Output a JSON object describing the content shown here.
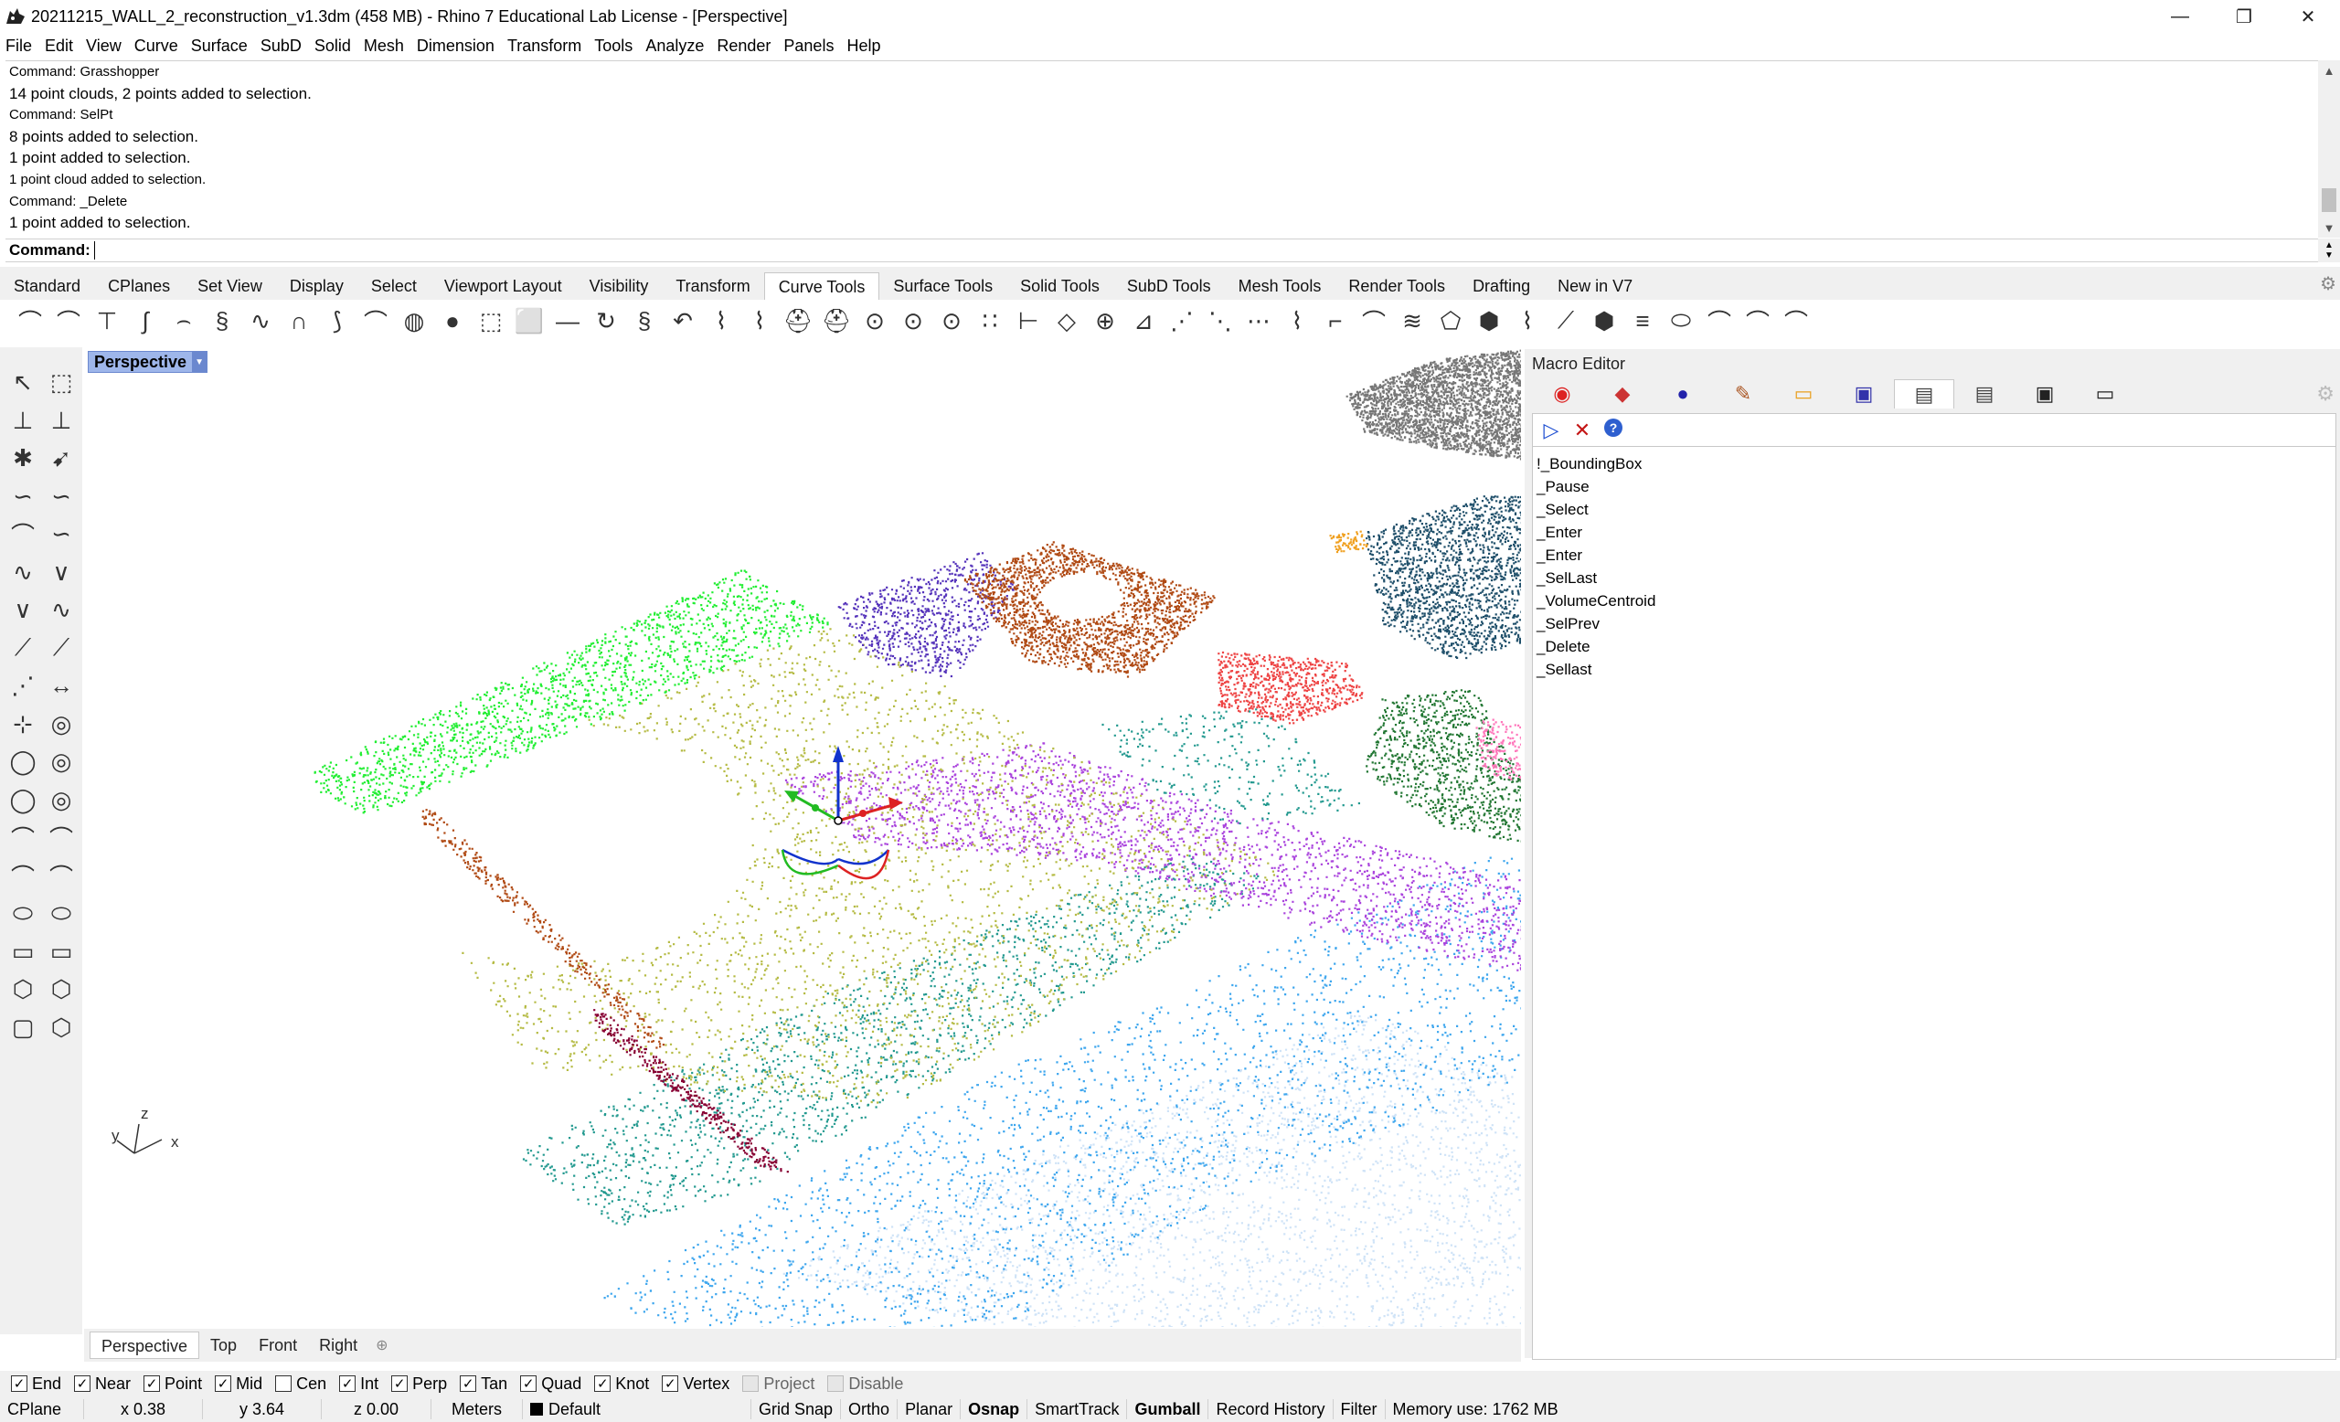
{
  "window": {
    "title": "20211215_WALL_2_reconstruction_v1.3dm (458 MB) - Rhino 7 Educational Lab License - [Perspective]",
    "minimize_glyph": "—",
    "restore_glyph": "❐",
    "close_glyph": "✕"
  },
  "menu": [
    "File",
    "Edit",
    "View",
    "Curve",
    "Surface",
    "SubD",
    "Solid",
    "Mesh",
    "Dimension",
    "Transform",
    "Tools",
    "Analyze",
    "Render",
    "Panels",
    "Help"
  ],
  "command_history": [
    {
      "text": "Command: Grasshopper",
      "size": "small"
    },
    {
      "text": "14 point clouds, 2 points added to selection.",
      "size": "big"
    },
    {
      "text": "Command: SelPt",
      "size": "small"
    },
    {
      "text": "8 points added to selection.",
      "size": "big"
    },
    {
      "text": "1 point added to selection.",
      "size": "big"
    },
    {
      "text": "1 point cloud added to selection.",
      "size": "small"
    },
    {
      "text": "Command: _Delete",
      "size": "small"
    },
    {
      "text": "1 point added to selection.",
      "size": "big"
    }
  ],
  "command_prompt": {
    "label": "Command:",
    "value": ""
  },
  "toolbar_tabs": {
    "items": [
      "Standard",
      "CPlanes",
      "Set View",
      "Display",
      "Select",
      "Viewport Layout",
      "Visibility",
      "Transform",
      "Curve Tools",
      "Surface Tools",
      "Solid Tools",
      "SubD Tools",
      "Mesh Tools",
      "Render Tools",
      "Drafting",
      "New in V7"
    ],
    "active": "Curve Tools"
  },
  "curve_tool_icons": [
    "fillet-curves-icon",
    "chamfer-curves-icon",
    "offset-curve-icon",
    "blend-curves-icon",
    "adjustable-blend-icon",
    "connect-curves-icon",
    "match-curve-icon",
    "arc-blend-icon",
    "tween-curves-icon",
    "extend-curve-icon",
    "extend-arc-icon",
    "point-on-curve-icon",
    "edit-points-icon",
    "project-to-surface-icon",
    "pull-curve-icon",
    "divide-curve-icon",
    "crv-start-icon",
    "crv-seam-icon",
    "change-degree-icon",
    "refit-curve-icon",
    "rebuild-curve-icon",
    "make-uniform-icon",
    "fit-curve-icon",
    "fix-curve-icon",
    "fair-curve-icon",
    "simplify-icon",
    "crv-length-icon",
    "divide-length-icon",
    "insert-point-icon",
    "remove-knot-icon",
    "curve-through-points-icon",
    "curve-through-polyline-icon",
    "symmetry-icon",
    "delete-segment-icon",
    "convert-polyline-icon",
    "explode-icon",
    "join-icon",
    "offset-multiple-icon",
    "sweep-icon",
    "flow-icon",
    "boundary-icon",
    "smooth-icon",
    "project-icon",
    "sketch-icon",
    "handle-curve-icon",
    "selected-curve-icon",
    "hatch-icon"
  ],
  "left_tool_icons": [
    "select-arrow-icon",
    "select-window-icon",
    "point-icon",
    "polyline-icon",
    "blend-icon",
    "arrow-icon",
    "interpolate-icon",
    "cv-curve-icon",
    "arc-icon",
    "rectangle-icon",
    "helix-icon",
    "spline-icon",
    "line-icon",
    "line-segment-icon",
    "polyline-2-icon",
    "line-2-icon",
    "point-2-icon",
    "arrow-2-icon",
    "circle-center-icon",
    "circle-tangent-icon",
    "circle-icon",
    "circle-2-icon",
    "arc-center-icon",
    "arc-2-icon",
    "arc-tangent-icon",
    "arc-3-icon",
    "ellipse-icon",
    "ellipse-2-icon",
    "rectangle-2-icon",
    "rectangle-3-icon",
    "polygon-icon",
    "polygon-2-icon",
    "freeform-icon",
    "box-icon",
    "cube-icon",
    "gumball-icon"
  ],
  "viewport": {
    "name": "Perspective",
    "axis_labels": {
      "x": "x",
      "y": "y",
      "z": "z"
    }
  },
  "viewport_tabs": {
    "items": [
      "Perspective",
      "Top",
      "Front",
      "Right"
    ],
    "active": "Perspective",
    "add_glyph": "⊕"
  },
  "panel": {
    "title": "Macro Editor",
    "tab_icons": [
      "color-wheel-icon",
      "material-icon",
      "environment-icon",
      "light-icon",
      "folder-icon",
      "layer-icon",
      "notes-icon",
      "document-icon",
      "camera-icon",
      "display-icon"
    ],
    "active_tab_index": 6,
    "macro_tool_icons": [
      "run-icon",
      "close-x-icon",
      "help-icon"
    ],
    "macro_lines": [
      "!_BoundingBox",
      "_Pause",
      "_Select",
      "_Enter",
      "_Enter",
      "_SelLast",
      "_VolumeCentroid",
      "_SelPrev",
      "_Delete",
      "_Sellast"
    ]
  },
  "osnaps": [
    {
      "label": "End",
      "checked": true
    },
    {
      "label": "Near",
      "checked": true
    },
    {
      "label": "Point",
      "checked": true
    },
    {
      "label": "Mid",
      "checked": true
    },
    {
      "label": "Cen",
      "checked": false
    },
    {
      "label": "Int",
      "checked": true
    },
    {
      "label": "Perp",
      "checked": true
    },
    {
      "label": "Tan",
      "checked": true
    },
    {
      "label": "Quad",
      "checked": true
    },
    {
      "label": "Knot",
      "checked": true
    },
    {
      "label": "Vertex",
      "checked": true
    },
    {
      "label": "Project",
      "checked": false,
      "disabled": true
    },
    {
      "label": "Disable",
      "checked": false,
      "disabled": true
    }
  ],
  "status": {
    "cplane": "CPlane",
    "x": "x 0.38",
    "y": "y 3.64",
    "z": "z 0.00",
    "units": "Meters",
    "layer": "Default",
    "toggles": [
      {
        "label": "Grid Snap",
        "bold": false
      },
      {
        "label": "Ortho",
        "bold": false
      },
      {
        "label": "Planar",
        "bold": false
      },
      {
        "label": "Osnap",
        "bold": true
      },
      {
        "label": "SmartTrack",
        "bold": false
      },
      {
        "label": "Gumball",
        "bold": true
      },
      {
        "label": "Record History",
        "bold": false
      },
      {
        "label": "Filter",
        "bold": false
      }
    ],
    "memory": "Memory use: 1762 MB"
  },
  "colors": {
    "viewport_label_bg": "#9eb6ea",
    "viewport_label_border": "#6b88cf",
    "cloud_olive": "#b5bb44",
    "cloud_green": "#22ee33",
    "cloud_purple": "#5533bb",
    "cloud_brown": "#b04a14",
    "cloud_red": "#ee4444",
    "cloud_teal": "#22998f",
    "cloud_blue": "#3da6ee",
    "cloud_lightblue": "#cfe3f7",
    "cloud_violet": "#aa44dd",
    "cloud_darkgreen": "#227733",
    "cloud_navy": "#1f4f6a",
    "cloud_gray": "#777777",
    "cloud_maroon": "#880033",
    "cloud_orange": "#f0a020",
    "cloud_pink": "#ff77bb",
    "gumball_x": "#dd2222",
    "gumball_y": "#22bb22",
    "gumball_z": "#1133cc"
  }
}
